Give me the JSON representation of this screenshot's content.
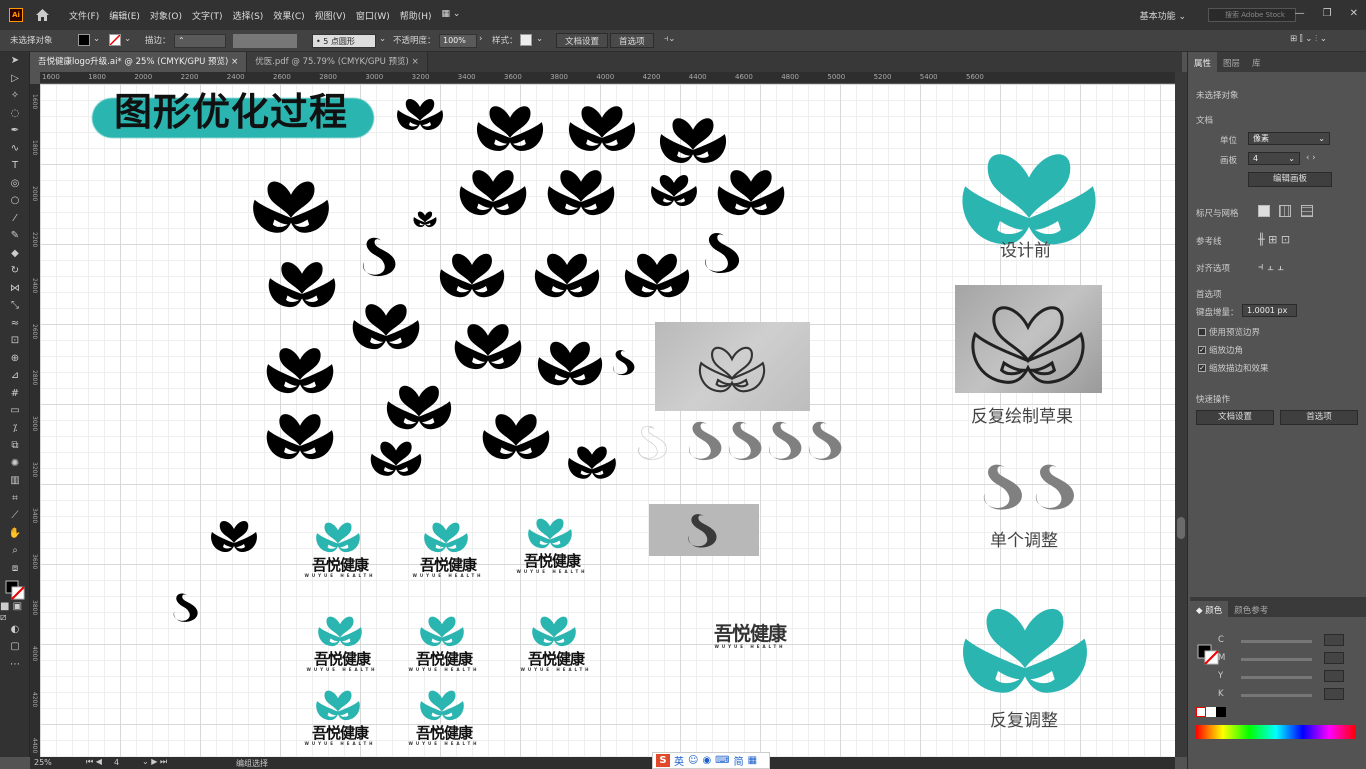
{
  "app": {
    "logo": "Ai",
    "workspace": "基本功能",
    "search_placeholder": "搜索 Adobe Stock"
  },
  "menu": [
    "文件(F)",
    "编辑(E)",
    "对象(O)",
    "文字(T)",
    "选择(S)",
    "效果(C)",
    "视图(V)",
    "窗口(W)",
    "帮助(H)"
  ],
  "control": {
    "selection": "未选择对象",
    "stroke_label": "描边：",
    "brush": "5 点圆形",
    "opacity_label": "不透明度：",
    "opacity_value": "100%",
    "style_label": "样式：",
    "doc_setup": "文档设置",
    "prefs": "首选项"
  },
  "tabs": [
    {
      "title": "吾悦健康logo升级.ai* @ 25% (CMYK/GPU 预览)",
      "close": "×"
    },
    {
      "title": "优医.pdf @ 75.79% (CMYK/GPU 预览)",
      "close": "×"
    }
  ],
  "ruler_marks": [
    "1600",
    "1800",
    "2000",
    "2200",
    "2400",
    "2600",
    "2800",
    "3000",
    "3200",
    "3400",
    "3600",
    "3800",
    "4000",
    "4200",
    "4400",
    "4600",
    "4800",
    "5000",
    "5200",
    "5400",
    "5600"
  ],
  "vruler_marks": [
    "1600",
    "1800",
    "2000",
    "2200",
    "2400",
    "2600",
    "2800",
    "3000",
    "3200",
    "3400",
    "3600",
    "3800",
    "4000",
    "4200",
    "4400"
  ],
  "artboard": {
    "heading": "图形优化过程",
    "brand_cn": "吾悦健康",
    "brand_en": "WUYUE HEALTH",
    "labels": {
      "before": "设计前",
      "sketch": "反复绘制草果",
      "adjust_single": "单个调整",
      "adjust_repeat": "反复调整"
    }
  },
  "status": {
    "zoom": "25%",
    "page": "4",
    "mode": "编组选择"
  },
  "properties": {
    "tabs": [
      "属性",
      "图层",
      "库"
    ],
    "no_selection": "未选择对象",
    "doc_section": "文档",
    "unit_label": "单位",
    "unit_value": "像素",
    "artboard_label": "画板",
    "artboard_value": "4",
    "edit_artboard": "编辑画板",
    "rulers_grid": "标尺与网格",
    "guides": "参考线",
    "align": "对齐选项",
    "prefs_section": "首选项",
    "key_increment_label": "键盘增量：",
    "key_increment_value": "1.0001 px",
    "preview_bounds": "使用预览边界",
    "scale_corners": "缩放边角",
    "scale_strokes": "缩放描边和效果",
    "quick_actions": "快速操作",
    "doc_setup": "文档设置",
    "prefs": "首选项",
    "preview_bounds_checked": false,
    "scale_corners_checked": true,
    "scale_strokes_checked": true
  },
  "color_panel": {
    "tabs": [
      "颜色",
      "颜色参考"
    ],
    "channels": [
      "C",
      "M",
      "Y",
      "K"
    ]
  },
  "ime": {
    "lang": "英",
    "simp": "简"
  },
  "colors": {
    "teal": "#2bb5b0",
    "black": "#0d0d0d",
    "gray": "#808080"
  }
}
